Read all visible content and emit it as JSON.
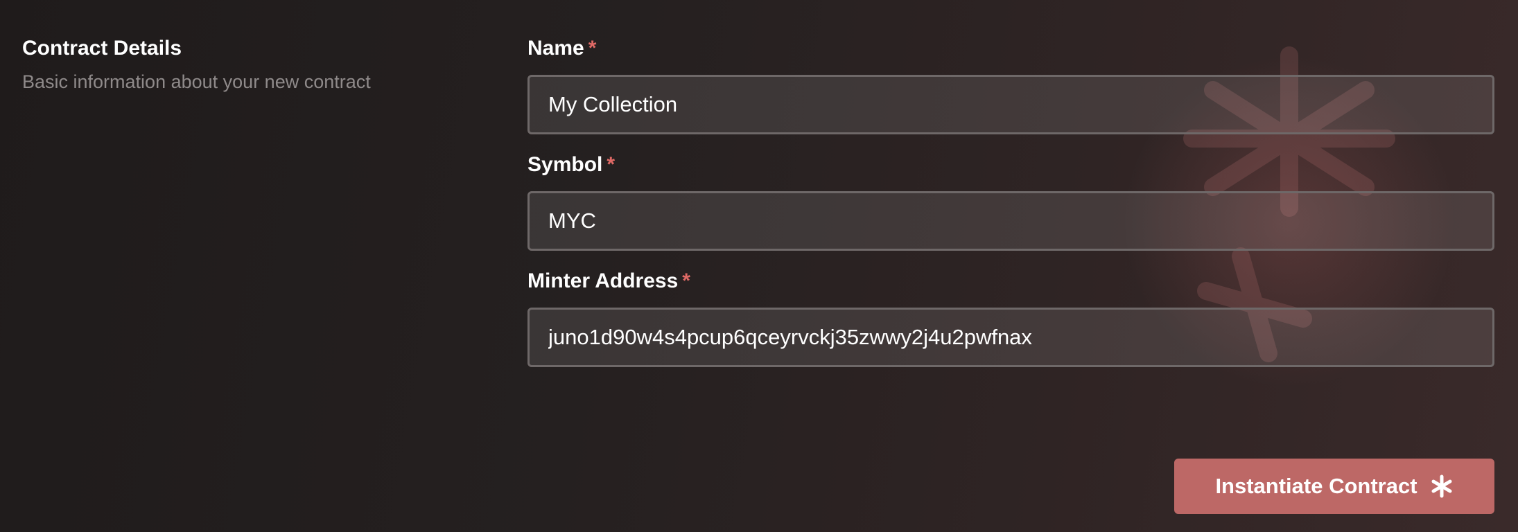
{
  "section": {
    "title": "Contract Details",
    "subtitle": "Basic information about your new contract"
  },
  "form": {
    "required_marker": "*",
    "fields": [
      {
        "label": "Name",
        "value": "My Collection"
      },
      {
        "label": "Symbol",
        "value": "MYC"
      },
      {
        "label": "Minter Address",
        "value": "juno1d90w4s4pcup6qceyrvckj35zwwy2j4u2pwfnax"
      }
    ]
  },
  "submit": {
    "label": "Instantiate Contract",
    "icon": "asterisk-icon"
  },
  "colors": {
    "accent_button": "#bd6866",
    "required_marker": "#e06a66"
  }
}
